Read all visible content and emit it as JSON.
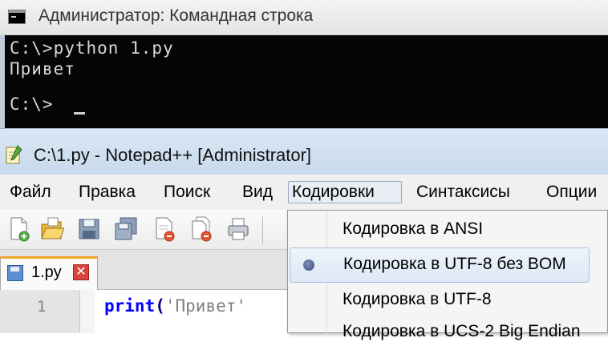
{
  "cmd_window": {
    "title": "Администратор: Командная строка",
    "lines": [
      "C:\\>python 1.py",
      "Привет",
      "",
      "C:\\>"
    ]
  },
  "npp_window": {
    "title": "C:\\1.py - Notepad++ [Administrator]",
    "menu": [
      "Файл",
      "Правка",
      "Поиск",
      "Вид",
      "Кодировки",
      "Синтаксисы",
      "Опции"
    ],
    "active_menu": "Кодировки",
    "toolbar_icons": [
      "new-file-icon",
      "open-file-icon",
      "save-icon",
      "save-all-icon",
      "close-icon",
      "close-all-icon",
      "print-icon"
    ],
    "tab": {
      "label": "1.py",
      "close_icon": "close-tab-icon"
    },
    "editor": {
      "line_number": "1",
      "code_keyword": "print",
      "code_paren": "(",
      "code_string": "'Привет'"
    }
  },
  "encoding_menu": {
    "items": [
      {
        "label": "Кодировка в ANSI",
        "selected": false
      },
      {
        "label": "Кодировка в UTF-8 без BOM",
        "selected": true
      },
      {
        "label": "Кодировка в UTF-8",
        "selected": false
      },
      {
        "label": "Кодировка в UCS-2 Big Endian",
        "selected": false
      }
    ]
  },
  "colors": {
    "console_bg": "#050505",
    "console_text": "#d8d8d8",
    "keyword": "#0000ff",
    "string": "#808080",
    "tab_accent": "#f0a428"
  }
}
